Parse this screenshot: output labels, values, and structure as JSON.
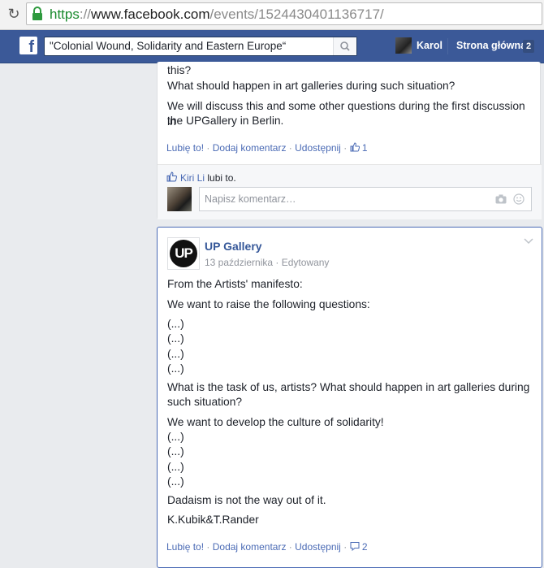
{
  "browser": {
    "url_scheme": "https",
    "url_sep": "://",
    "url_host": "www.facebook.com",
    "url_path": "/events/1524430401136717/"
  },
  "topbar": {
    "logo": "f",
    "search_value": "\"Colonial Wound, Solidarity and Eastern Europe“",
    "user_name": "Karol",
    "home_label": "Strona główna",
    "home_badge": "2"
  },
  "post1": {
    "lines": [
      "this?",
      "What should happen in art galleries during such situation?",
      "We will discuss this and some other questions during the first discussion in",
      "the UPGallery in Berlin."
    ],
    "actions": {
      "like": "Lubię to!",
      "comment": "Dodaj komentarz",
      "share": "Udostępnij",
      "like_count": "1"
    },
    "likes": {
      "who": "Kiri Li",
      "suffix": " lubi to."
    },
    "comment_placeholder": "Napisz komentarz…"
  },
  "post2": {
    "logo_text": "UP",
    "author": "UP Gallery",
    "meta": "13 października · Edytowany",
    "lines": [
      "From the Artists' manifesto:",
      "We want to raise the following questions:",
      "(...)",
      "(...)",
      "(...)",
      "(...)",
      "What is the task of us, artists? What should happen in art galleries during",
      "such situation?",
      "We want to develop the culture of solidarity!",
      "(...)",
      "(...)",
      "(...)",
      "(...)",
      "Dadaism is not the way out of it.",
      "K.Kubik&T.Rander"
    ],
    "actions": {
      "like": "Lubię to!",
      "comment": "Dodaj komentarz",
      "share": "Udostępnij",
      "comment_count": "2"
    }
  },
  "colors": {
    "fb_blue": "#3b5998",
    "link_blue": "#4b6bb5",
    "url_green": "#1a8b2e"
  }
}
